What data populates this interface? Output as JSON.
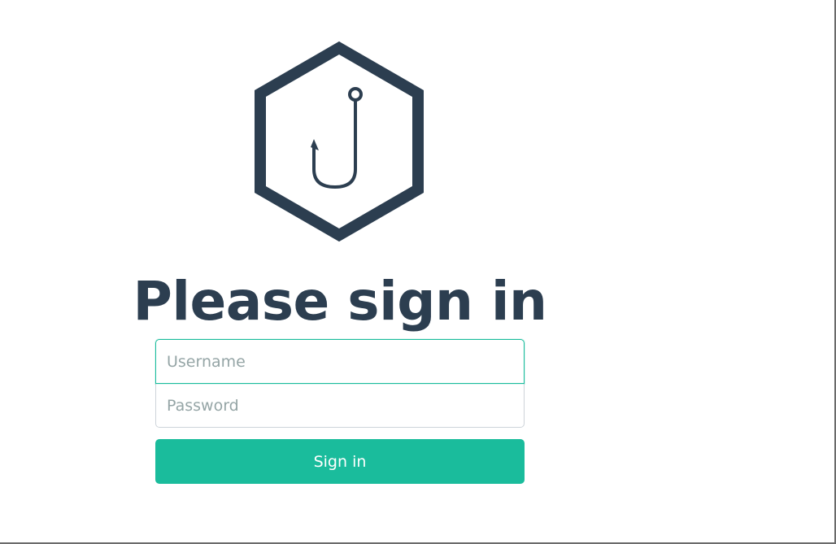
{
  "logo": {
    "icon": "fishing-hook-hexagon-icon",
    "color": "#2c3e50"
  },
  "heading": "Please sign in",
  "form": {
    "username_placeholder": "Username",
    "password_placeholder": "Password",
    "submit_label": "Sign in"
  },
  "colors": {
    "primary": "#1abc9c",
    "text": "#2c3e50",
    "placeholder": "#95a5a6"
  }
}
